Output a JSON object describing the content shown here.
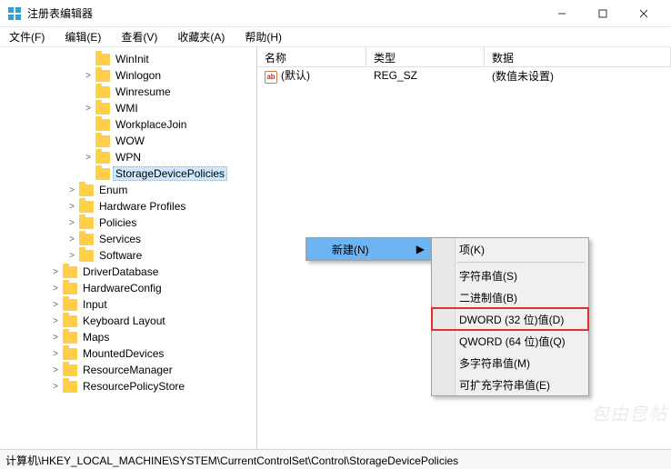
{
  "window": {
    "title": "注册表编辑器"
  },
  "menubar": {
    "file": "文件(F)",
    "edit": "编辑(E)",
    "view": "查看(V)",
    "fav": "收藏夹(A)",
    "help": "帮助(H)"
  },
  "tree": {
    "nodes": [
      {
        "indent": 3,
        "exp": "",
        "label": "WinInit"
      },
      {
        "indent": 3,
        "exp": ">",
        "label": "Winlogon"
      },
      {
        "indent": 3,
        "exp": "",
        "label": "Winresume"
      },
      {
        "indent": 3,
        "exp": ">",
        "label": "WMI"
      },
      {
        "indent": 3,
        "exp": "",
        "label": "WorkplaceJoin"
      },
      {
        "indent": 3,
        "exp": "",
        "label": "WOW"
      },
      {
        "indent": 3,
        "exp": ">",
        "label": "WPN"
      },
      {
        "indent": 3,
        "exp": "",
        "label": "StorageDevicePolicies",
        "selected": true
      },
      {
        "indent": 2,
        "exp": ">",
        "label": "Enum"
      },
      {
        "indent": 2,
        "exp": ">",
        "label": "Hardware Profiles"
      },
      {
        "indent": 2,
        "exp": ">",
        "label": "Policies"
      },
      {
        "indent": 2,
        "exp": ">",
        "label": "Services"
      },
      {
        "indent": 2,
        "exp": ">",
        "label": "Software"
      },
      {
        "indent": 1,
        "exp": ">",
        "label": "DriverDatabase"
      },
      {
        "indent": 1,
        "exp": ">",
        "label": "HardwareConfig"
      },
      {
        "indent": 1,
        "exp": ">",
        "label": "Input"
      },
      {
        "indent": 1,
        "exp": ">",
        "label": "Keyboard Layout"
      },
      {
        "indent": 1,
        "exp": ">",
        "label": "Maps"
      },
      {
        "indent": 1,
        "exp": ">",
        "label": "MountedDevices"
      },
      {
        "indent": 1,
        "exp": ">",
        "label": "ResourceManager"
      },
      {
        "indent": 1,
        "exp": ">",
        "label": "ResourcePolicyStore"
      }
    ]
  },
  "list": {
    "cols": {
      "name": "名称",
      "type": "类型",
      "data": "数据"
    },
    "rows": [
      {
        "name": "(默认)",
        "type": "REG_SZ",
        "data": "(数值未设置)"
      }
    ]
  },
  "context": {
    "new": "新建(N)",
    "arrow": "▶",
    "sub": {
      "key": "项(K)",
      "string": "字符串值(S)",
      "binary": "二进制值(B)",
      "dword": "DWORD (32 位)值(D)",
      "qword": "QWORD (64 位)值(Q)",
      "multi": "多字符串值(M)",
      "expand": "可扩充字符串值(E)"
    }
  },
  "statusbar": "计算机\\HKEY_LOCAL_MACHINE\\SYSTEM\\CurrentControlSet\\Control\\StorageDevicePolicies"
}
